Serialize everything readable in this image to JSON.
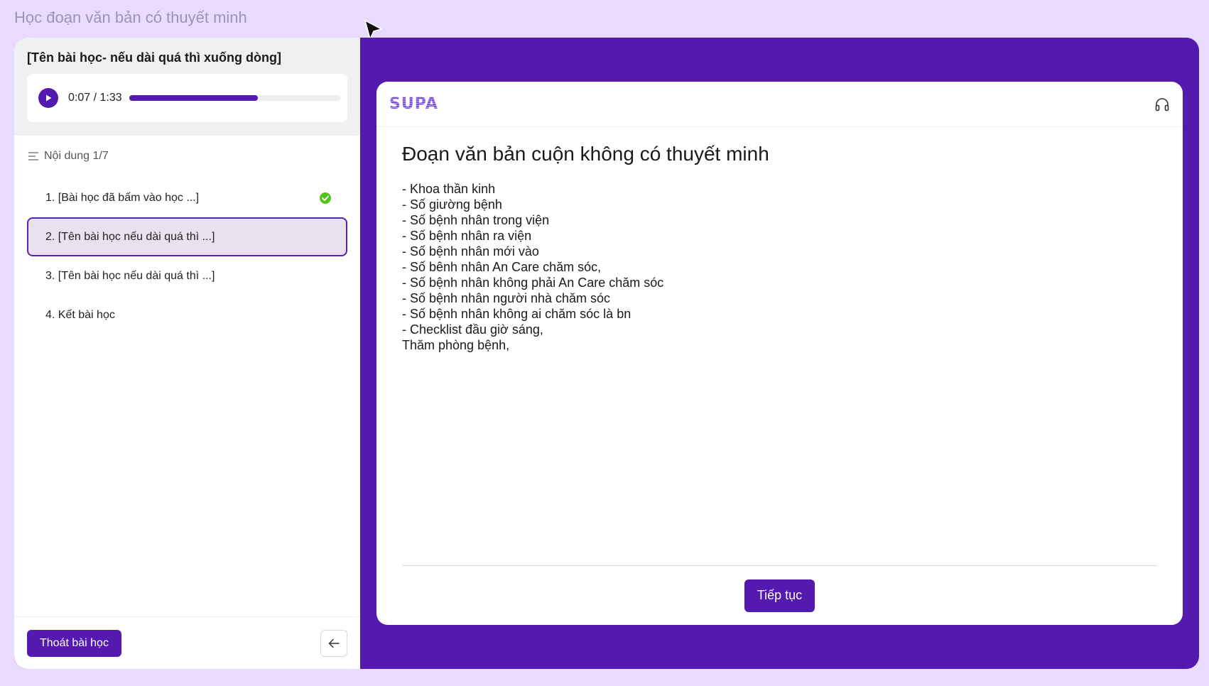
{
  "window": {
    "title": "Học đoạn văn bản có thuyết minh"
  },
  "sidebar": {
    "lesson_title": "[Tên bài học- nếu dài quá thì xuống dòng]",
    "audio": {
      "time": "0:07 / 1:33",
      "progress": 0.61
    },
    "toc_label": "Nội dung 1/7",
    "items": [
      {
        "label": "1. [Bài học đã bấm vào học ...]",
        "completed": true
      },
      {
        "label": "2. [Tên bài học nếu dài quá thì ...]",
        "active": true
      },
      {
        "label": "3. [Tên bài học nếu dài quá thì ...]"
      },
      {
        "label": "4. Kết bài học"
      }
    ],
    "exit_label": "Thoát bài học"
  },
  "card": {
    "logo": "SUPA",
    "title": "Đoạn văn bản cuộn không có thuyết minh",
    "lines": [
      "- Khoa thần kinh",
      "- Số giường bệnh",
      "- Số bệnh nhân trong viện",
      "- Số bệnh nhân ra viện",
      "- Số bệnh nhân mới vào",
      "- Số bênh nhân An Care chăm sóc,",
      "- Số bệnh nhân không phải An Care chăm sóc",
      "- Số bệnh nhân người nhà chăm sóc",
      "- Số bệnh nhân không ai chăm sóc là bn",
      "- Checklist đầu giờ sáng,",
      "Thăm phòng bệnh,"
    ],
    "continue_label": "Tiếp tục"
  },
  "colors": {
    "primary": "#5419ae",
    "background": "#e9dbff",
    "success": "#52c41a"
  }
}
